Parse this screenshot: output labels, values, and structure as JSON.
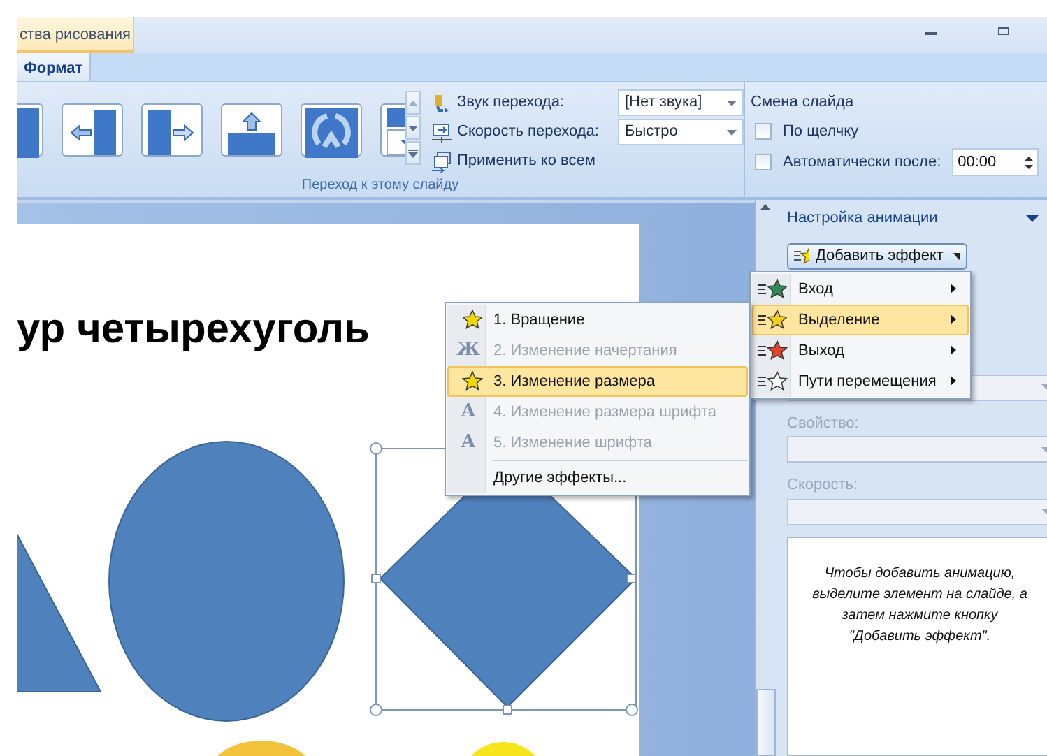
{
  "title_bar": {
    "contextual_tab": "ства рисования"
  },
  "ribbon_tabs": [
    {
      "label": "Формат",
      "selected": true
    }
  ],
  "transition_group": {
    "label": "Переход к этому слайду",
    "sound": {
      "label": "Звук перехода:",
      "value": "[Нет звука]"
    },
    "speed": {
      "label": "Скорость перехода:",
      "value": "Быстро"
    },
    "apply_all": "Применить ко всем"
  },
  "slide_change": {
    "title": "Смена слайда",
    "on_click": {
      "label": "По щелчку",
      "checked": false
    },
    "auto": {
      "label": "Автоматически после:",
      "checked": false,
      "value": "00:00"
    }
  },
  "slide": {
    "title": "ур четырехуголь"
  },
  "task_pane": {
    "title": "Настройка анимации",
    "add_button": "Добавить эффект",
    "property_label": "Свойство:",
    "speed_label": "Скорость:",
    "hint": "Чтобы добавить анимацию, выделите элемент на слайде, а затем нажмите кнопку \"Добавить эффект\"."
  },
  "effect_menu": [
    {
      "label": "Вход",
      "selected": false,
      "color": "#2e8b57"
    },
    {
      "label": "Выделение",
      "selected": true,
      "color": "#f2d017"
    },
    {
      "label": "Выход",
      "selected": false,
      "color": "#e5432d"
    },
    {
      "label": "Пути перемещения",
      "selected": false,
      "color": "#ffffff"
    }
  ],
  "emphasis_menu": [
    {
      "kind": "star",
      "label": "1. Вращение",
      "disabled": false,
      "selected": false
    },
    {
      "kind": "glyph",
      "glyph": "Ж",
      "label": "2. Изменение начертания",
      "disabled": true,
      "selected": false
    },
    {
      "kind": "star",
      "label": "3. Изменение размера",
      "disabled": false,
      "selected": true
    },
    {
      "kind": "glyph",
      "glyph": "A",
      "label": "4. Изменение размера шрифта",
      "disabled": true,
      "selected": false
    },
    {
      "kind": "glyph",
      "glyph": "A",
      "label": "5. Изменение шрифта",
      "disabled": true,
      "selected": false
    },
    {
      "kind": "more",
      "label": "Другие эффекты...",
      "disabled": false,
      "selected": false
    }
  ]
}
